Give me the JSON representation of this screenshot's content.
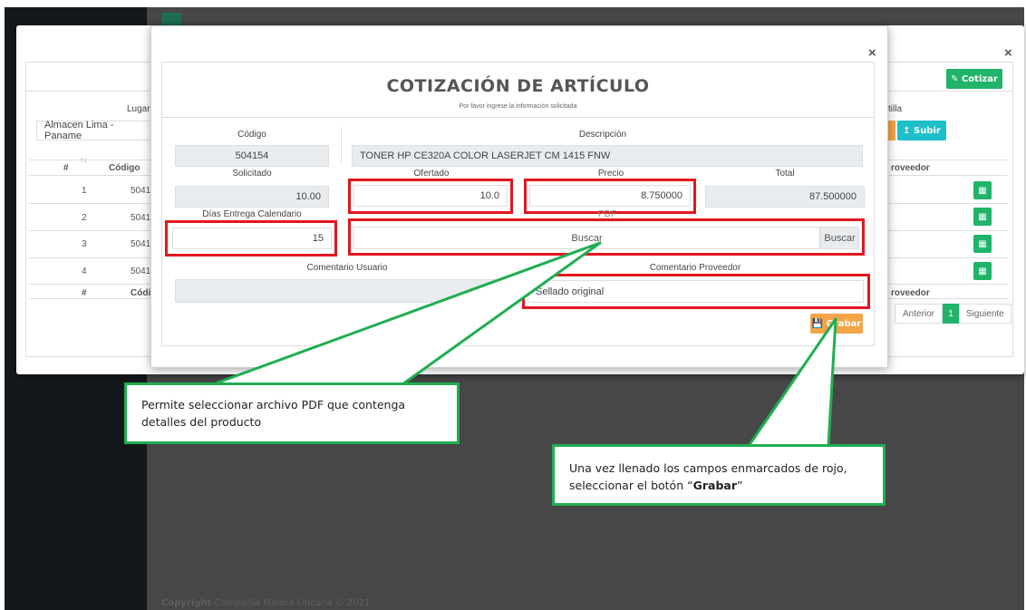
{
  "outer": {
    "cotizar_label": "Cotizar",
    "lugar_label": "Lugar de",
    "lugar_value": "Almacen Lima - Paname",
    "plantilla_label": "tilla",
    "subir_label": "Subir",
    "table": {
      "headers": [
        "#",
        "Código",
        "roveedor"
      ],
      "rows": [
        {
          "n": "1",
          "codigo": "5041"
        },
        {
          "n": "2",
          "codigo": "5041"
        },
        {
          "n": "3",
          "codigo": "5041"
        },
        {
          "n": "4",
          "codigo": "5041"
        }
      ],
      "footer": [
        "#",
        "Códi",
        "roveedor"
      ]
    },
    "pagination": {
      "prev": "Anterior",
      "page": "1",
      "next": "Siguiente"
    }
  },
  "modal": {
    "title": "COTIZACIÓN DE ARTÍCULO",
    "subtitle": "Por favor ingrese la información solicitada",
    "codigo_label": "Código",
    "codigo_value": "504154",
    "descripcion_label": "Descripción",
    "descripcion_value": "TONER HP CE320A COLOR LASERJET CM 1415 FNW",
    "solicitado_label": "Solicitado",
    "solicitado_value": "10.00",
    "ofertado_label": "Ofertado",
    "ofertado_value": "10.0",
    "precio_label": "Precio",
    "precio_value": "8.750000",
    "total_label": "Total",
    "total_value": "87.500000",
    "dias_label": "Días Entrega Calendario",
    "dias_value": "15",
    "pdf_label": "PDF",
    "pdf_placeholder": "Buscar",
    "pdf_button": "Buscar",
    "comentario_usuario_label": "Comentario Usuario",
    "comentario_proveedor_label": "Comentario Proveedor",
    "comentario_proveedor_value": "Sellado original",
    "grabar_label": "Grabar"
  },
  "callouts": {
    "pdf_note": "Permite seleccionar archivo PDF que contenga detalles del producto",
    "grabar_note_pre": "Una vez llenado los campos enmarcados de rojo, seleccionar el botón “",
    "grabar_note_bold": "Grabar",
    "grabar_note_post": "”"
  },
  "footer": {
    "copyright_label": "Copyright",
    "company": "Compañía Minera Lincuna © 2021"
  },
  "colors": {
    "highlight_red": "#e3161e",
    "callout_green": "#1fae50",
    "grabar_orange": "#f3a447",
    "cotizar_green": "#20b36a"
  }
}
